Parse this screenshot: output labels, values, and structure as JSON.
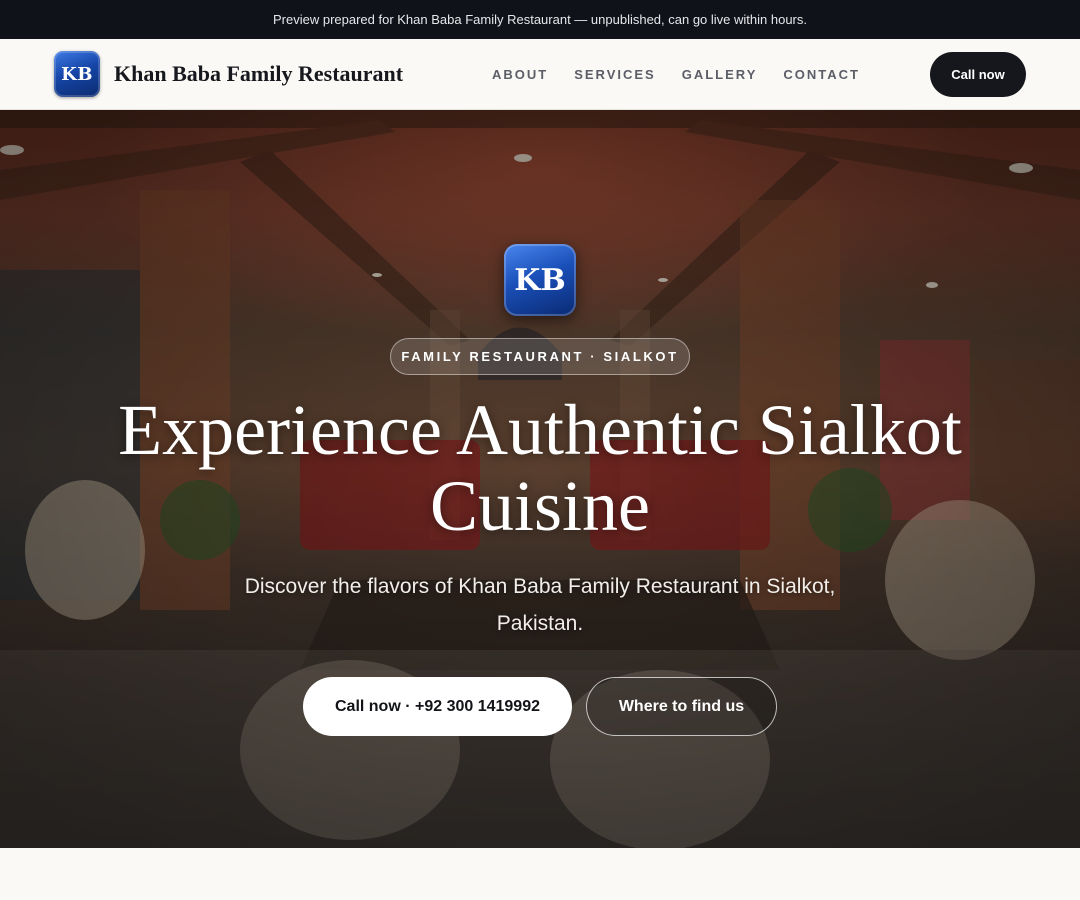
{
  "preview_banner": {
    "text": "Preview prepared for Khan Baba Family Restaurant — unpublished, can go live within hours."
  },
  "header": {
    "logo_text": "KB",
    "brand_name": "Khan Baba Family Restaurant",
    "nav": [
      {
        "label": "ABOUT"
      },
      {
        "label": "SERVICES"
      },
      {
        "label": "GALLERY"
      },
      {
        "label": "CONTACT"
      }
    ],
    "cta_label": "Call now"
  },
  "hero": {
    "logo_text": "KB",
    "tag": "FAMILY RESTAURANT · SIALKOT",
    "title": "Experience Authentic Sialkot Cuisine",
    "subtitle": "Discover the flavors of Khan Baba Family Restaurant in Sialkot, Pakistan.",
    "primary_cta": "Call now · +92 300 1419992",
    "secondary_cta": "Where to find us",
    "background": "restaurant-interior-photo"
  },
  "colors": {
    "banner_bg": "#0f1218",
    "header_bg": "#faf9f6",
    "dark_button": "#15171c",
    "logo_blue": "#1646a8"
  }
}
